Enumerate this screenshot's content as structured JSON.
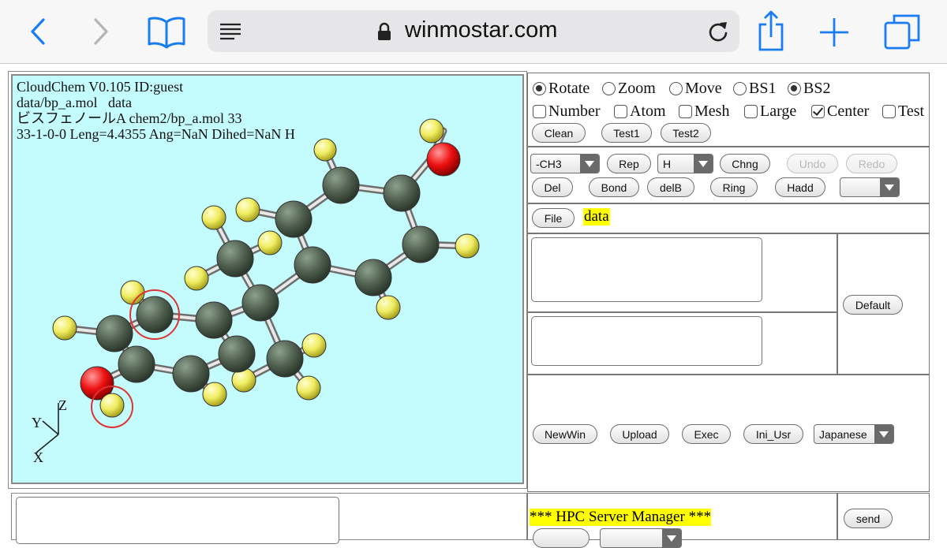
{
  "browser": {
    "url": "winmostar.com",
    "icons": [
      "back-chevron-icon",
      "forward-chevron-icon",
      "bookmarks-book-icon",
      "reader-lines-icon",
      "lock-icon",
      "reload-icon",
      "share-icon",
      "new-tab-plus-icon",
      "tabs-icon"
    ]
  },
  "viewer": {
    "line1": "CloudChem V0.105 ID:guest",
    "line2": "data/bp_a.mol   data",
    "line3": "ビスフェノールA chem2/bp_a.mol 33",
    "line4": "33-1-0-0 Leng=4.4355 Ang=NaN Dihed=NaN H",
    "axis_y": "Y",
    "axis_z": "Z",
    "axis_x": "X",
    "colors": {
      "background": "#c4fcfd",
      "carbon": "#4e5e4e",
      "hydrogen": "#f0ec60",
      "oxygen": "#ee1111",
      "selection": "#dd3333"
    }
  },
  "view_modes": [
    "Rotate",
    "Zoom",
    "Move",
    "BS1",
    "BS2"
  ],
  "view_modes_selected": [
    "Rotate",
    "BS2"
  ],
  "checkboxes": [
    "Number",
    "Atom",
    "Mesh",
    "Large",
    "Center",
    "Test"
  ],
  "checkboxes_checked": [
    "Center"
  ],
  "row1_buttons": {
    "clean": "Clean",
    "test1": "Test1",
    "test2": "Test2"
  },
  "edit": {
    "group_select": "-CH3",
    "rep": "Rep",
    "atom_select": "H",
    "chng": "Chng",
    "undo": "Undo",
    "redo": "Redo",
    "del": "Del",
    "bond": "Bond",
    "delb": "delB",
    "ring": "Ring",
    "hadd": "Hadd",
    "extra_select": ""
  },
  "file": {
    "button": "File",
    "name": "data"
  },
  "default_button": "Default",
  "actions": {
    "newwin": "NewWin",
    "upload": "Upload",
    "exec": "Exec",
    "ini_usr": "Ini_Usr",
    "language": "Japanese"
  },
  "hpc": {
    "title": "*** HPC Server Manager ***",
    "send": "send"
  }
}
